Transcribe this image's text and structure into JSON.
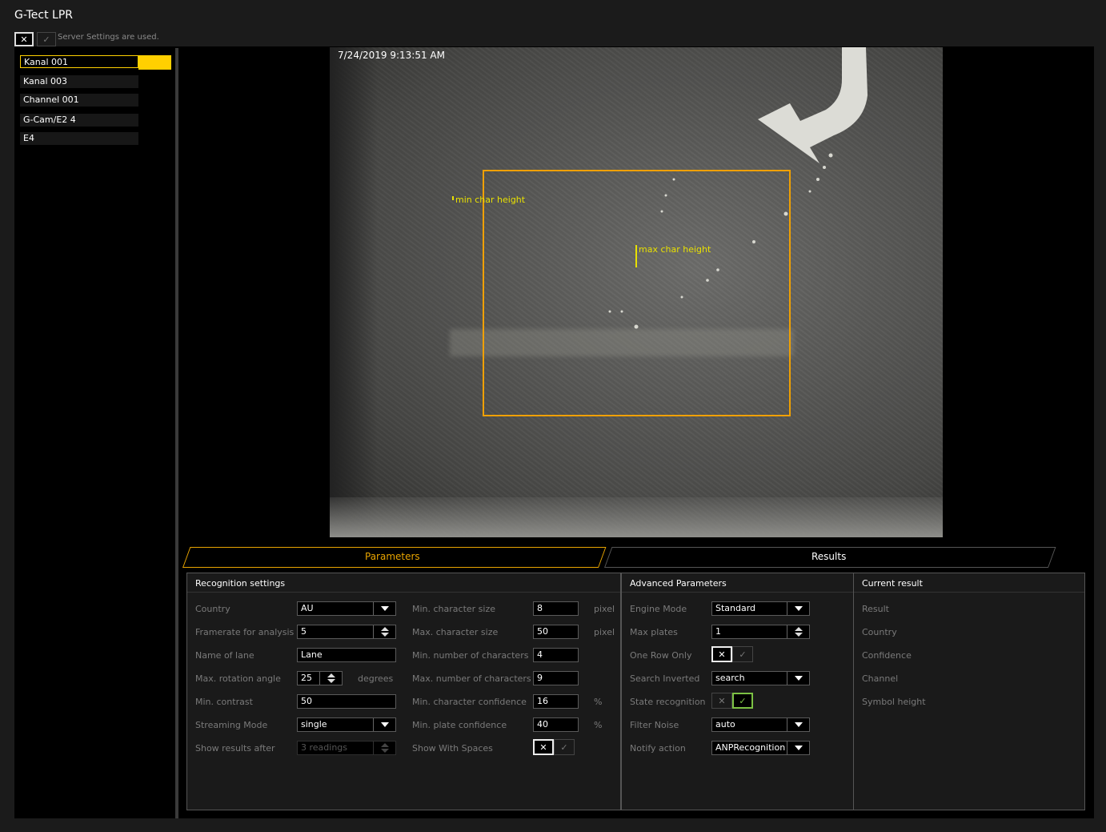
{
  "app": {
    "title": "G-Tect LPR"
  },
  "server_settings": {
    "x_glyph": "✕",
    "check_glyph": "✓",
    "label": "Server Settings are used."
  },
  "channels": [
    {
      "label": "Kanal 001",
      "active": true
    },
    {
      "label": "Kanal 003",
      "active": false
    },
    {
      "label": "Channel 001",
      "active": false
    },
    {
      "label": "G-Cam/E2 4",
      "active": false
    },
    {
      "label": "E4",
      "active": false
    }
  ],
  "video": {
    "timestamp": "7/24/2019 9:13:51 AM",
    "min_char_label": "min char height",
    "max_char_label": "max char height"
  },
  "tabs": {
    "parameters": "Parameters",
    "results": "Results"
  },
  "recognition": {
    "title": "Recognition settings",
    "country": {
      "label": "Country",
      "value": "AU"
    },
    "framerate": {
      "label": "Framerate for analysis",
      "value": "5"
    },
    "lane_name": {
      "label": "Name of lane",
      "value": "Lane"
    },
    "rotation": {
      "label": "Max. rotation angle",
      "value": "25",
      "unit": "degrees"
    },
    "contrast": {
      "label": "Min. contrast",
      "value": "50"
    },
    "streaming": {
      "label": "Streaming Mode",
      "value": "single"
    },
    "show_after": {
      "label": "Show results after",
      "value": "3 readings"
    },
    "min_char_size": {
      "label": "Min. character size",
      "value": "8",
      "unit": "pixel"
    },
    "max_char_size": {
      "label": "Max. character size",
      "value": "50",
      "unit": "pixel"
    },
    "min_num_chars": {
      "label": "Min. number of characters",
      "value": "4"
    },
    "max_num_chars": {
      "label": "Max. number of characters",
      "value": "9"
    },
    "min_char_conf": {
      "label": "Min. character confidence",
      "value": "16",
      "unit": "%"
    },
    "min_plate_conf": {
      "label": "Min. plate confidence",
      "value": "40",
      "unit": "%"
    },
    "show_spaces": {
      "label": "Show With Spaces",
      "x_glyph": "✕",
      "check_glyph": "✓"
    }
  },
  "advanced": {
    "title": "Advanced Parameters",
    "engine_mode": {
      "label": "Engine Mode",
      "value": "Standard"
    },
    "max_plates": {
      "label": "Max plates",
      "value": "1"
    },
    "one_row": {
      "label": "One Row Only",
      "x_glyph": "✕",
      "check_glyph": "✓"
    },
    "search_inverted": {
      "label": "Search Inverted",
      "value": "search"
    },
    "state_recognition": {
      "label": "State recognition",
      "x_glyph": "✕",
      "check_glyph": "✓"
    },
    "filter_noise": {
      "label": "Filter Noise",
      "value": "auto"
    },
    "notify_action": {
      "label": "Notify action",
      "value": "ANPRecognition"
    }
  },
  "current_result": {
    "title": "Current result",
    "fields": [
      "Result",
      "Country",
      "Confidence",
      "Channel",
      "Symbol height"
    ]
  },
  "colors": {
    "accent": "#ffd000",
    "roi": "#f0a000",
    "overlay_text": "#e8e000",
    "check_on": "#7cc144"
  }
}
